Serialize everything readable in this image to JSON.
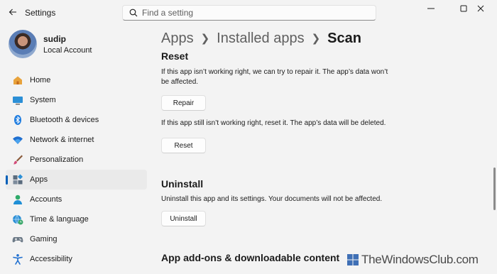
{
  "window": {
    "title": "Settings"
  },
  "search": {
    "placeholder": "Find a setting"
  },
  "profile": {
    "name": "sudip",
    "account_type": "Local Account"
  },
  "nav": {
    "items": [
      {
        "label": "Home",
        "icon": "home-icon",
        "active": false
      },
      {
        "label": "System",
        "icon": "system-icon",
        "active": false
      },
      {
        "label": "Bluetooth & devices",
        "icon": "bluetooth-icon",
        "active": false
      },
      {
        "label": "Network & internet",
        "icon": "wifi-icon",
        "active": false
      },
      {
        "label": "Personalization",
        "icon": "brush-icon",
        "active": false
      },
      {
        "label": "Apps",
        "icon": "apps-icon",
        "active": true
      },
      {
        "label": "Accounts",
        "icon": "accounts-icon",
        "active": false
      },
      {
        "label": "Time & language",
        "icon": "globe-clock-icon",
        "active": false
      },
      {
        "label": "Gaming",
        "icon": "gamepad-icon",
        "active": false
      },
      {
        "label": "Accessibility",
        "icon": "accessibility-icon",
        "active": false
      }
    ]
  },
  "breadcrumb": {
    "items": [
      "Apps",
      "Installed apps",
      "Scan"
    ]
  },
  "reset_section": {
    "title": "Reset",
    "repair_desc": "If this app isn’t working right, we can try to repair it. The app’s data won’t be affected.",
    "repair_label": "Repair",
    "reset_desc": "If this app still isn’t working right, reset it. The app’s data will be deleted.",
    "reset_label": "Reset"
  },
  "uninstall_section": {
    "title": "Uninstall",
    "desc": "Uninstall this app and its settings. Your documents will not be affected.",
    "button_label": "Uninstall"
  },
  "addons_section": {
    "title": "App add-ons & downloadable content"
  },
  "watermark": {
    "text": "TheWindowsClub.com"
  },
  "colors": {
    "accent": "#005fb8",
    "background": "#f3f3f3",
    "active_nav": "#eaeaea"
  }
}
